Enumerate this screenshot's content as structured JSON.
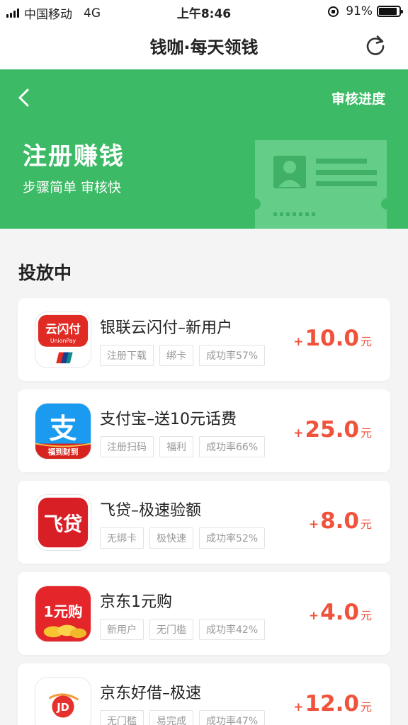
{
  "status_bar": {
    "carrier": "中国移动",
    "network": "4G",
    "time": "上午8:46",
    "battery": "91%",
    "battery_level": 0.91
  },
  "nav": {
    "title": "钱咖·每天领钱",
    "refresh_icon": "refresh-icon"
  },
  "hero": {
    "back_icon": "chevron-left-icon",
    "progress_link": "审核进度",
    "title": "注册赚钱",
    "subtitle": "步骤简单 审核快",
    "colors": {
      "green": "#3dba66",
      "ticket": "#64cd88"
    }
  },
  "section": {
    "title": "投放中"
  },
  "tasks": [
    {
      "icon": "unionpay-app-icon",
      "name": "银联云闪付–新用户",
      "tags": [
        "注册下载",
        "绑卡",
        "成功率57%"
      ],
      "plus": "+",
      "amount": "10.0",
      "unit": "元"
    },
    {
      "icon": "alipay-app-icon",
      "name": "支付宝–送10元话费",
      "tags": [
        "注册扫码",
        "福利",
        "成功率66%"
      ],
      "plus": "+",
      "amount": "25.0",
      "unit": "元"
    },
    {
      "icon": "feidai-app-icon",
      "name": "飞贷–极速验额",
      "tags": [
        "无绑卡",
        "极快速",
        "成功率52%"
      ],
      "plus": "+",
      "amount": "8.0",
      "unit": "元"
    },
    {
      "icon": "jd-one-yuan-app-icon",
      "name": "京东1元购",
      "tags": [
        "新用户",
        "无门槛",
        "成功率42%"
      ],
      "plus": "+",
      "amount": "4.0",
      "unit": "元"
    },
    {
      "icon": "jd-haojie-app-icon",
      "name": "京东好借–极速",
      "tags": [
        "无门槛",
        "易完成",
        "成功率47%"
      ],
      "plus": "+",
      "amount": "12.0",
      "unit": "元"
    }
  ],
  "icon_text": {
    "unionpay": [
      "云闪付",
      "UnionPay"
    ],
    "alipay": [
      "支",
      "福到财到"
    ],
    "feidai": "飞贷",
    "jd_one": "1元购",
    "jd_haojie": "JD"
  },
  "accent_color": "#f0523b"
}
